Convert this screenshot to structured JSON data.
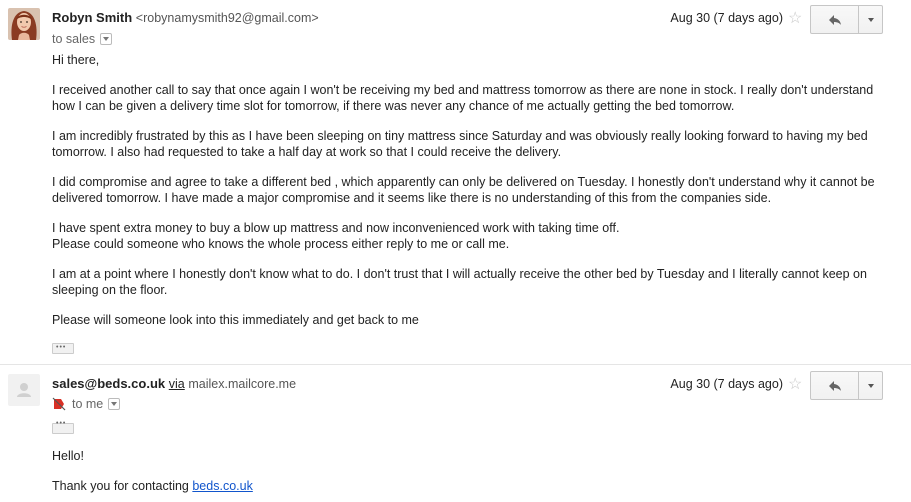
{
  "messages": [
    {
      "sender_name": "Robyn Smith",
      "sender_email": "<robynamysmith92@gmail.com>",
      "recipient": "to sales",
      "date": "Aug 30 (7 days ago)",
      "body": [
        "Hi there,",
        "I received another call to say that once again I won't be receiving my bed and mattress tomorrow as there are none in stock. I really don't understand how I can be given a delivery time slot for tomorrow, if there was never any chance of me actually getting the bed tomorrow.",
        "I am incredibly frustrated by this as I have been sleeping on  tiny mattress since Saturday and was obviously really looking forward to having my bed tomorrow. I also had requested to take a half day at work so that I could receive the delivery.",
        "I did compromise and agree to take a different bed , which apparently can only be delivered on Tuesday. I honestly don't understand why it cannot be delivered tomorrow. I have made a major compromise and it seems like there is no understanding of this from the companies side.",
        "I have spent extra money to buy a blow up mattress and now inconvenienced work with taking time off.",
        "Please could someone who knows the whole process either reply to me or call me.",
        "I am at a point where I honestly don't know what to do. I  don't trust that I will actually receive the other bed by Tuesday and I literally cannot keep on sleeping on the floor.",
        "Please will someone look into this immediately and get back to me"
      ]
    },
    {
      "sender_email": "sales@beds.co.uk",
      "via_label": "via",
      "via_host": "mailex.mailcore.me",
      "recipient": "to me",
      "date": "Aug 30 (7 days ago)",
      "body": [
        "Hello!",
        "Thank you for contacting "
      ],
      "link": "beds.co.uk"
    }
  ],
  "icons": {
    "star": "star-outline-icon",
    "reply": "reply-arrow-icon",
    "more": "chevron-down-icon",
    "avatar_default": "person-silhouette-icon",
    "important": "important-marker-icon"
  },
  "colors": {
    "link": "#1155cc",
    "divider": "#e5e5e5",
    "button_border": "#c6c6c6",
    "star": "#c8c8c8"
  }
}
